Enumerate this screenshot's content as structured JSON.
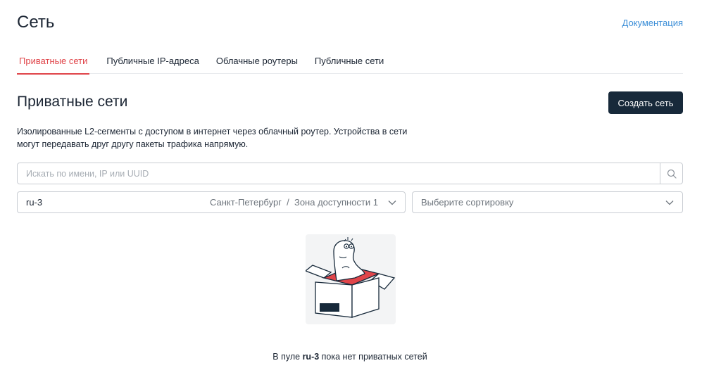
{
  "header": {
    "title": "Сеть",
    "docs_link": "Документация"
  },
  "tabs": [
    {
      "label": "Приватные сети",
      "active": true
    },
    {
      "label": "Публичные IP-адреса",
      "active": false
    },
    {
      "label": "Облачные роутеры",
      "active": false
    },
    {
      "label": "Публичные сети",
      "active": false
    }
  ],
  "section": {
    "title": "Приватные сети",
    "create_button": "Создать сеть",
    "description": "Изолированные L2-сегменты с доступом в интернет через облачный роутер. Устройства в сети могут передавать друг другу пакеты трафика напрямую."
  },
  "search": {
    "placeholder": "Искать по имени, IP или UUID",
    "value": "",
    "icon": "search-icon"
  },
  "region_select": {
    "value": "ru-3",
    "location": "Санкт-Петербург  /  Зона доступности 1",
    "icon": "chevron-down-icon"
  },
  "sort_select": {
    "placeholder": "Выберите сортировку",
    "icon": "chevron-down-icon"
  },
  "empty_state": {
    "prefix": "В пуле ",
    "pool": "ru-3",
    "suffix": " пока нет приватных сетей",
    "illustration": "dino-in-box"
  },
  "colors": {
    "accent": "#e0454a",
    "link": "#3d8fd8",
    "button_bg": "#17293a"
  }
}
